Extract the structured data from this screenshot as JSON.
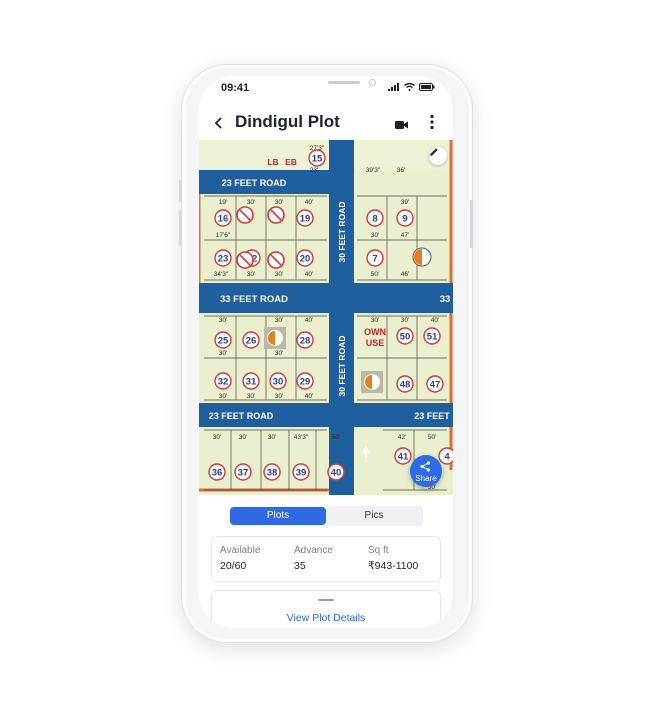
{
  "status_bar": {
    "time": "09:41"
  },
  "header": {
    "title": "Dindigul Plot",
    "back_icon": "chevron-left-icon",
    "video_icon": "video-icon",
    "more_icon": "more-vertical-icon"
  },
  "map": {
    "roads": {
      "top": "23 FEET ROAD",
      "middle": "33 FEET ROAD",
      "middle_right": "33",
      "bottom_left": "23 FEET ROAD",
      "bottom_right": "23 FEET",
      "vertical_top": "30 FEET ROAD",
      "vertical_bottom": "30 FEET ROAD"
    },
    "labels": {
      "lb": "LB",
      "eb": "EB",
      "own_use_1": "OWN",
      "own_use_2": "USE"
    },
    "plots": [
      "15",
      "16",
      "19",
      "8",
      "9",
      "23",
      "22",
      "20",
      "7",
      "25",
      "26",
      "28",
      "50",
      "51",
      "32",
      "31",
      "30",
      "29",
      "48",
      "47",
      "36",
      "37",
      "38",
      "39",
      "40",
      "41",
      "4"
    ],
    "dimensions": [
      "27'3\"",
      "23'",
      "39'3\"",
      "36'",
      "19'",
      "30'",
      "30'",
      "40'",
      "39'",
      "17'6\"",
      "30'",
      "47'",
      "34'3\"",
      "30'",
      "30'",
      "40'",
      "50'",
      "46'",
      "30'",
      "30'",
      "40'",
      "30'",
      "30'",
      "30'",
      "30'",
      "40'",
      "30'",
      "30'",
      "30'",
      "40'",
      "30'",
      "30'",
      "30'",
      "43'3\"",
      "50'",
      "42'",
      "50'",
      "50'"
    ],
    "colors": {
      "road": "#1f5f9e",
      "plot": "#e9efcf",
      "border": "#dd6f36",
      "circle": "#d6393a"
    }
  },
  "share": {
    "label": "Share",
    "icon": "share-icon"
  },
  "edit": {
    "icon": "pencil-icon"
  },
  "tabs": {
    "plots": "Plots",
    "pics": "Pics"
  },
  "stats": [
    {
      "label": "Available",
      "value": "20/60"
    },
    {
      "label": "Advance",
      "value": "35"
    },
    {
      "label": "Sq ft",
      "value": "₹943-1100"
    }
  ],
  "details": {
    "link": "View Plot Details"
  }
}
